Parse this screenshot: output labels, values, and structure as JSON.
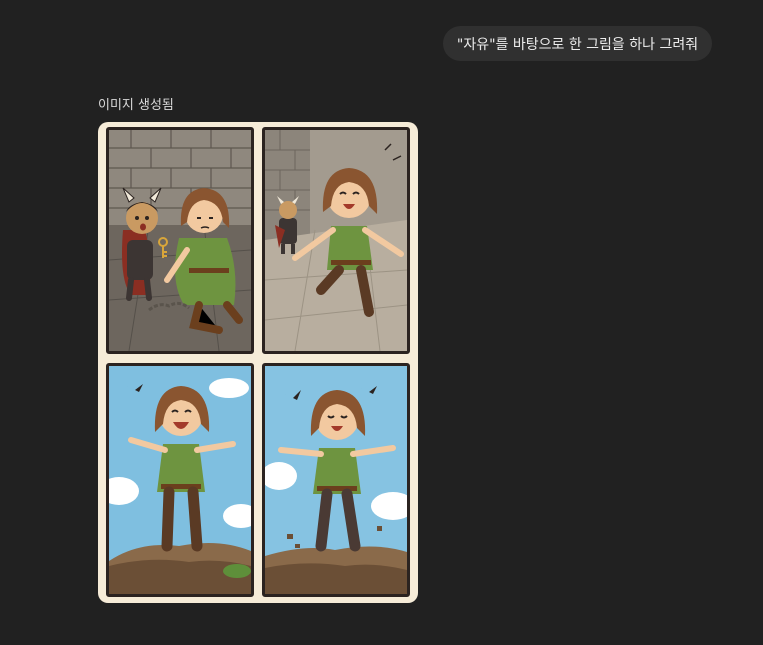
{
  "chat": {
    "user_message": "\"자유\"를 바탕으로 한 그림을 하나 그려줘",
    "status_label": "이미지 생성됨"
  },
  "image": {
    "panels": [
      {
        "name": "escape-panel"
      },
      {
        "name": "run-panel"
      },
      {
        "name": "cliff-joy-panel"
      },
      {
        "name": "cliff-crumble-panel"
      }
    ]
  }
}
